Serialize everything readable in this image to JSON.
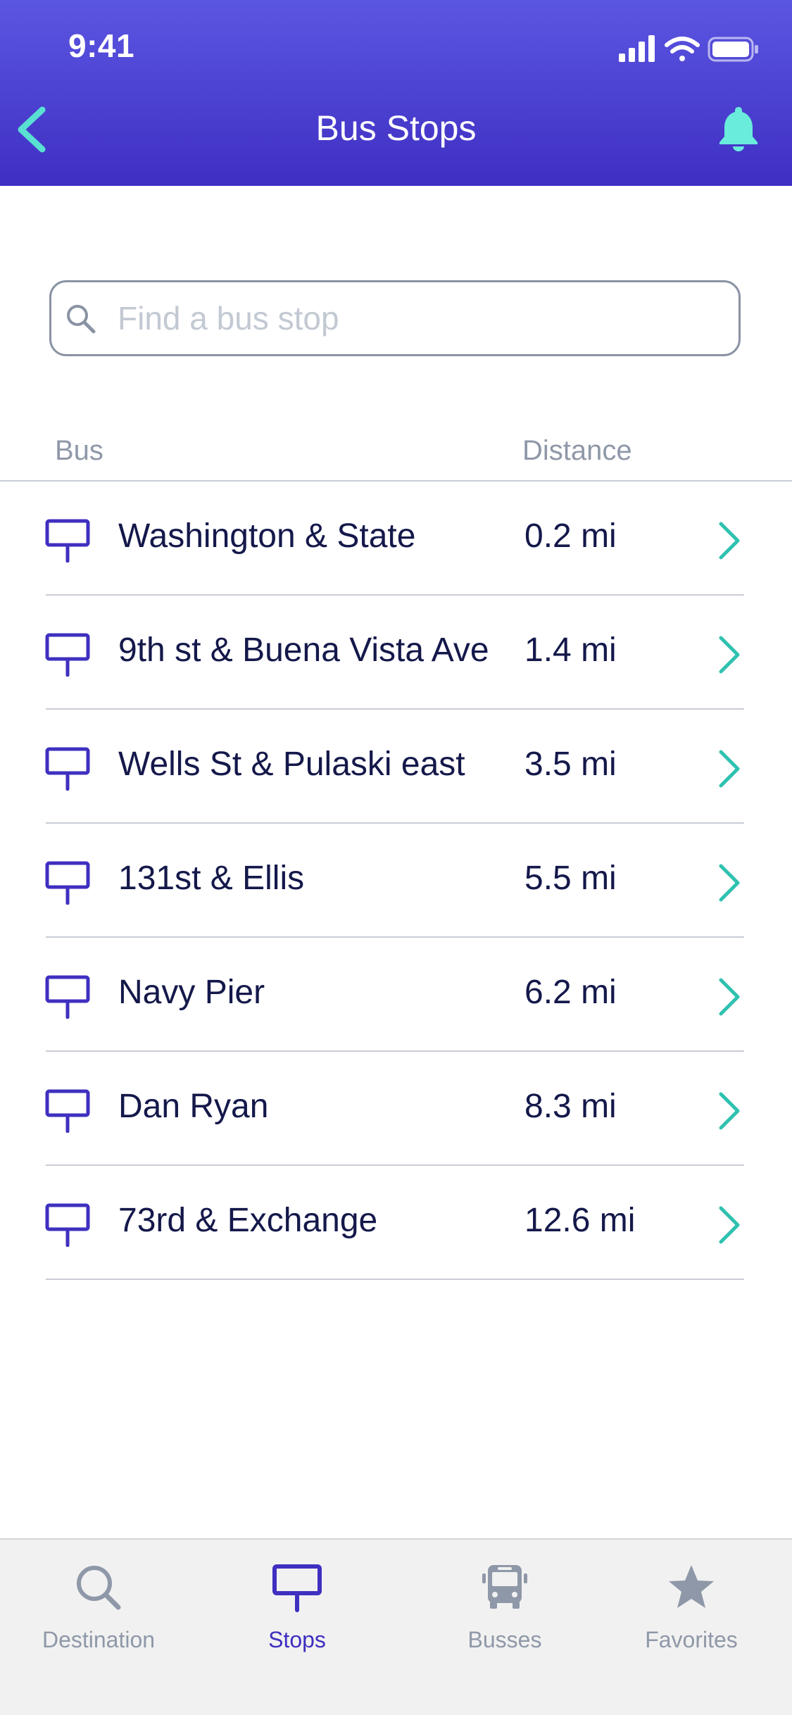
{
  "status_bar": {
    "time": "9:41"
  },
  "nav": {
    "title": "Bus Stops",
    "back_icon": "chevron-left-icon",
    "bell_icon": "bell-icon"
  },
  "search": {
    "placeholder": "Find a bus stop",
    "value": ""
  },
  "columns": {
    "bus": "Bus",
    "distance": "Distance"
  },
  "stops": [
    {
      "name": "Washington & State",
      "distance": "0.2 mi"
    },
    {
      "name": "9th st & Buena Vista Ave",
      "distance": "1.4 mi"
    },
    {
      "name": "Wells St & Pulaski east",
      "distance": "3.5 mi"
    },
    {
      "name": "131st & Ellis",
      "distance": "5.5 mi"
    },
    {
      "name": "Navy Pier",
      "distance": "6.2 mi"
    },
    {
      "name": "Dan Ryan",
      "distance": "8.3 mi"
    },
    {
      "name": "73rd & Exchange",
      "distance": "12.6 mi"
    }
  ],
  "tabs": [
    {
      "label": "Destination",
      "icon": "search-icon",
      "active": false
    },
    {
      "label": "Stops",
      "icon": "bus-stop-icon",
      "active": true
    },
    {
      "label": "Busses",
      "icon": "bus-icon",
      "active": false
    },
    {
      "label": "Favorites",
      "icon": "star-icon",
      "active": false
    }
  ],
  "colors": {
    "header_top": "#5b56e2",
    "header_bottom": "#3f2fc2",
    "accent_teal": "#2fc1b0",
    "stop_icon": "#3f30c0",
    "text_primary": "#14184a",
    "text_muted": "#8f98a8"
  }
}
